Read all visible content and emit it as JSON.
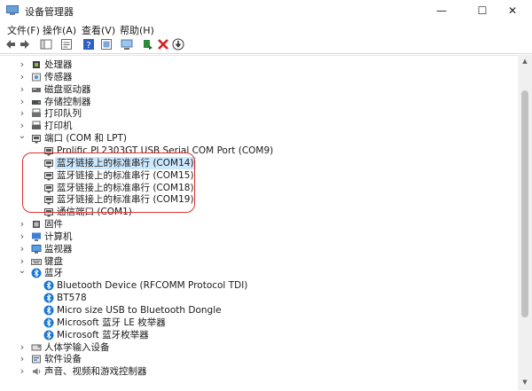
{
  "window": {
    "title": "设备管理器",
    "minimize_glyph": "—",
    "maximize_glyph": "☐",
    "close_glyph": "✕"
  },
  "menu": [
    {
      "label": "文件(F)"
    },
    {
      "label": "操作(A)"
    },
    {
      "label": "查看(V)"
    },
    {
      "label": "帮助(H)"
    }
  ],
  "toolbar": {
    "icons": [
      "back-arrow-icon",
      "forward-arrow-icon",
      "show-hide-tree-icon",
      "properties-icon",
      "help-icon",
      "update-driver-icon",
      "scan-hardware-icon",
      "enable-device-icon",
      "uninstall-icon",
      "download-icon"
    ]
  },
  "tree": [
    {
      "label": "处理器",
      "level": 1,
      "expanded": false,
      "icon": "processor-icon"
    },
    {
      "label": "传感器",
      "level": 1,
      "expanded": false,
      "icon": "sensor-icon"
    },
    {
      "label": "磁盘驱动器",
      "level": 1,
      "expanded": false,
      "icon": "disk-drive-icon"
    },
    {
      "label": "存储控制器",
      "level": 1,
      "expanded": false,
      "icon": "storage-controller-icon"
    },
    {
      "label": "打印队列",
      "level": 1,
      "expanded": false,
      "icon": "print-queue-icon"
    },
    {
      "label": "打印机",
      "level": 1,
      "expanded": false,
      "icon": "printer-icon"
    },
    {
      "label": "端口 (COM 和 LPT)",
      "level": 1,
      "expanded": true,
      "icon": "port-icon"
    },
    {
      "label": "Prolific PL2303GT USB Serial COM Port (COM9)",
      "level": 2,
      "icon": "port-icon"
    },
    {
      "label": "蓝牙链接上的标准串行 (COM14)",
      "level": 2,
      "icon": "port-icon",
      "selected": true
    },
    {
      "label": "蓝牙链接上的标准串行 (COM15)",
      "level": 2,
      "icon": "port-icon"
    },
    {
      "label": "蓝牙链接上的标准串行 (COM18)",
      "level": 2,
      "icon": "port-icon"
    },
    {
      "label": "蓝牙链接上的标准串行 (COM19)",
      "level": 2,
      "icon": "port-icon"
    },
    {
      "label": "通信端口 (COM1)",
      "level": 2,
      "icon": "port-icon"
    },
    {
      "label": "固件",
      "level": 1,
      "expanded": false,
      "icon": "firmware-icon"
    },
    {
      "label": "计算机",
      "level": 1,
      "expanded": false,
      "icon": "computer-icon"
    },
    {
      "label": "监视器",
      "level": 1,
      "expanded": false,
      "icon": "monitor-icon"
    },
    {
      "label": "键盘",
      "level": 1,
      "expanded": false,
      "icon": "keyboard-icon"
    },
    {
      "label": "蓝牙",
      "level": 1,
      "expanded": true,
      "icon": "bluetooth-icon"
    },
    {
      "label": "Bluetooth Device (RFCOMM Protocol TDI)",
      "level": 2,
      "icon": "bluetooth-icon"
    },
    {
      "label": "BT578",
      "level": 2,
      "icon": "bluetooth-icon"
    },
    {
      "label": "Micro size USB to Bluetooth Dongle",
      "level": 2,
      "icon": "bluetooth-icon"
    },
    {
      "label": "Microsoft 蓝牙 LE 枚举器",
      "level": 2,
      "icon": "bluetooth-icon"
    },
    {
      "label": "Microsoft 蓝牙枚举器",
      "level": 2,
      "icon": "bluetooth-icon"
    },
    {
      "label": "人体学输入设备",
      "level": 1,
      "expanded": false,
      "icon": "hid-icon"
    },
    {
      "label": "软件设备",
      "level": 1,
      "expanded": false,
      "icon": "software-device-icon"
    },
    {
      "label": "声音、视频和游戏控制器",
      "level": 1,
      "expanded": false,
      "icon": "sound-icon"
    }
  ],
  "colors": {
    "selection": "#cce8ff",
    "annotation_ring": "#e03030",
    "bluetooth": "#1976d2"
  }
}
